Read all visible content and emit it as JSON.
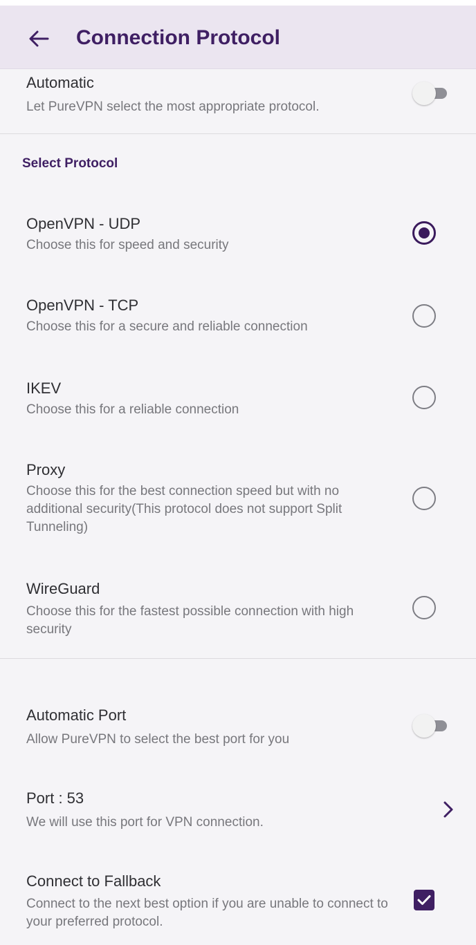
{
  "appbar": {
    "title": "Connection Protocol"
  },
  "automatic": {
    "title": "Automatic",
    "subtitle": "Let PureVPN select the most appropriate protocol.",
    "enabled": false
  },
  "section": {
    "label": "Select Protocol"
  },
  "protocols": [
    {
      "title": "OpenVPN - UDP",
      "subtitle": "Choose this for speed and security",
      "selected": true
    },
    {
      "title": "OpenVPN - TCP",
      "subtitle": "Choose this for a secure and reliable connection",
      "selected": false
    },
    {
      "title": "IKEV",
      "subtitle": "Choose this for a reliable connection",
      "selected": false
    },
    {
      "title": "Proxy",
      "subtitle": "Choose this for the best connection speed but with no additional security(This protocol does not support Split Tunneling)",
      "selected": false
    },
    {
      "title": "WireGuard",
      "subtitle": "Choose this for the fastest possible connection with high security",
      "selected": false
    }
  ],
  "automatic_port": {
    "title": "Automatic Port",
    "subtitle": "Allow PureVPN to select the best port for you",
    "enabled": false
  },
  "port": {
    "title": "Port : 53",
    "subtitle": "We will use this port for VPN connection."
  },
  "fallback": {
    "title": "Connect to Fallback",
    "subtitle": "Connect to the next best option if you are unable to connect to your preferred protocol.",
    "checked": true
  },
  "icons": {
    "back": "arrow-left-icon",
    "chevron": "chevron-right-icon",
    "check": "checkmark-icon"
  },
  "colors": {
    "accent": "#3f1f63",
    "appbar_bg": "#ebe5f0",
    "page_bg": "#f5f4f7",
    "toggle_off_track": "#8f8f96"
  }
}
